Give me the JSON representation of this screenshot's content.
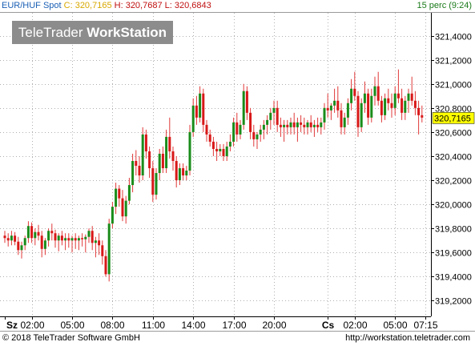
{
  "header": {
    "symbol": "EUR/HUF Spot",
    "close": "C: 320,7165",
    "high": "H: 320,7687",
    "low": "L: 320,6843",
    "interval": "15 perc (9:24)"
  },
  "logo": {
    "brand_light": "TeleTrader ",
    "brand_bold": "WorkStation"
  },
  "footer": {
    "copyright": "© 2018 TeleTrader Software GmbH",
    "url": "http://workstation.teletrader.com"
  },
  "colors": {
    "up": "#1a8c1a",
    "down": "#d81818",
    "wick": "#e03838",
    "grid": "#b0b0b0",
    "last_price_bg": "#ffff00"
  },
  "chart_data": {
    "type": "candlestick",
    "title": "EUR/HUF Spot",
    "interval": "15 perc",
    "last_price_label": "320,7165",
    "last_price": 320.7165,
    "y_ticks": [
      {
        "value": 321.4,
        "label": "321,4000"
      },
      {
        "value": 321.2,
        "label": "321,2000"
      },
      {
        "value": 321.0,
        "label": "321,0000"
      },
      {
        "value": 320.8,
        "label": "320,8000"
      },
      {
        "value": 320.6,
        "label": "320,6000"
      },
      {
        "value": 320.4,
        "label": "320,4000"
      },
      {
        "value": 320.2,
        "label": "320,2000"
      },
      {
        "value": 320.0,
        "label": "320,0000"
      },
      {
        "value": 319.8,
        "label": "319,8000"
      },
      {
        "value": 319.6,
        "label": "319,6000"
      },
      {
        "value": 319.4,
        "label": "319,4000"
      },
      {
        "value": 319.2,
        "label": "319,2000"
      }
    ],
    "ylim": [
      319.07,
      321.59
    ],
    "x_ticks": [
      {
        "bar": 0,
        "label": "Sz",
        "bold": true
      },
      {
        "bar": 8,
        "label": "02:00",
        "bold": false
      },
      {
        "bar": 20,
        "label": "05:00",
        "bold": false
      },
      {
        "bar": 32,
        "label": "08:00",
        "bold": false
      },
      {
        "bar": 44,
        "label": "11:00",
        "bold": false
      },
      {
        "bar": 56,
        "label": "14:00",
        "bold": false
      },
      {
        "bar": 68,
        "label": "17:00",
        "bold": false
      },
      {
        "bar": 80,
        "label": "20:00",
        "bold": false
      },
      {
        "bar": 96,
        "label": "Cs",
        "bold": true
      },
      {
        "bar": 104,
        "label": "02:00",
        "bold": false
      },
      {
        "bar": 116,
        "label": "05:00",
        "bold": false
      },
      {
        "bar": 125,
        "label": "07:15",
        "bold": false
      }
    ],
    "grid": true,
    "candles": [
      [
        319.74,
        319.78,
        319.68,
        319.72
      ],
      [
        319.72,
        319.76,
        319.65,
        319.7
      ],
      [
        319.7,
        319.78,
        319.66,
        319.74
      ],
      [
        319.74,
        319.77,
        319.66,
        319.69
      ],
      [
        319.69,
        319.73,
        319.58,
        319.62
      ],
      [
        319.62,
        319.69,
        319.55,
        319.66
      ],
      [
        319.66,
        319.74,
        319.62,
        319.72
      ],
      [
        319.72,
        319.86,
        319.68,
        319.82
      ],
      [
        319.82,
        319.85,
        319.68,
        319.72
      ],
      [
        319.72,
        319.8,
        319.66,
        319.77
      ],
      [
        319.77,
        319.83,
        319.7,
        319.74
      ],
      [
        319.74,
        319.78,
        319.56,
        319.63
      ],
      [
        319.63,
        319.72,
        319.58,
        319.7
      ],
      [
        319.7,
        319.8,
        319.65,
        319.78
      ],
      [
        319.78,
        319.84,
        319.7,
        319.76
      ],
      [
        319.76,
        319.79,
        319.64,
        319.7
      ],
      [
        319.7,
        319.76,
        319.61,
        319.74
      ],
      [
        319.74,
        319.78,
        319.66,
        319.7
      ],
      [
        319.7,
        319.76,
        319.62,
        319.72
      ],
      [
        319.72,
        319.76,
        319.64,
        319.7
      ],
      [
        319.7,
        319.74,
        319.6,
        319.72
      ],
      [
        319.72,
        319.76,
        319.63,
        319.7
      ],
      [
        319.7,
        319.74,
        319.62,
        319.72
      ],
      [
        319.72,
        319.76,
        319.65,
        319.71
      ],
      [
        319.71,
        319.75,
        319.6,
        319.73
      ],
      [
        319.73,
        319.8,
        319.68,
        319.78
      ],
      [
        319.78,
        319.82,
        319.62,
        319.68
      ],
      [
        319.68,
        319.73,
        319.56,
        319.7
      ],
      [
        319.7,
        319.76,
        319.58,
        319.66
      ],
      [
        319.66,
        319.7,
        319.5,
        319.57
      ],
      [
        319.57,
        319.62,
        319.4,
        319.42
      ],
      [
        319.42,
        319.88,
        319.36,
        319.84
      ],
      [
        319.84,
        320.02,
        319.8,
        319.98
      ],
      [
        319.98,
        320.18,
        319.92,
        320.13
      ],
      [
        320.13,
        320.16,
        319.98,
        320.05
      ],
      [
        320.05,
        320.12,
        319.86,
        319.9
      ],
      [
        319.9,
        320.07,
        319.84,
        320.03
      ],
      [
        320.03,
        320.22,
        320.0,
        320.16
      ],
      [
        320.16,
        320.42,
        320.1,
        320.36
      ],
      [
        320.36,
        320.45,
        320.24,
        320.32
      ],
      [
        320.32,
        320.4,
        320.18,
        320.24
      ],
      [
        320.24,
        320.64,
        320.2,
        320.58
      ],
      [
        320.58,
        320.62,
        320.38,
        320.44
      ],
      [
        320.44,
        320.48,
        320.22,
        320.3
      ],
      [
        320.3,
        320.36,
        320.02,
        320.08
      ],
      [
        320.08,
        320.3,
        320.04,
        320.26
      ],
      [
        320.26,
        320.46,
        320.2,
        320.42
      ],
      [
        320.42,
        320.48,
        320.26,
        320.3
      ],
      [
        320.3,
        320.62,
        320.26,
        320.56
      ],
      [
        320.56,
        320.72,
        320.38,
        320.44
      ],
      [
        320.44,
        320.48,
        320.28,
        320.36
      ],
      [
        320.36,
        320.4,
        320.14,
        320.2
      ],
      [
        320.2,
        320.34,
        320.16,
        320.3
      ],
      [
        320.3,
        320.34,
        320.2,
        320.24
      ],
      [
        320.24,
        320.32,
        320.2,
        320.28
      ],
      [
        320.28,
        320.66,
        320.24,
        320.6
      ],
      [
        320.6,
        320.88,
        320.56,
        320.82
      ],
      [
        320.82,
        320.9,
        320.66,
        320.72
      ],
      [
        320.72,
        320.98,
        320.68,
        320.92
      ],
      [
        320.92,
        320.96,
        320.6,
        320.66
      ],
      [
        320.66,
        320.7,
        320.52,
        320.58
      ],
      [
        320.58,
        320.62,
        320.48,
        320.52
      ],
      [
        320.52,
        320.56,
        320.4,
        320.46
      ],
      [
        320.46,
        320.52,
        320.36,
        320.44
      ],
      [
        320.44,
        320.5,
        320.4,
        320.46
      ],
      [
        320.46,
        320.5,
        320.36,
        320.4
      ],
      [
        320.4,
        320.52,
        320.36,
        320.48
      ],
      [
        320.48,
        320.58,
        320.44,
        320.52
      ],
      [
        320.52,
        320.72,
        320.48,
        320.68
      ],
      [
        320.68,
        320.76,
        320.52,
        320.58
      ],
      [
        320.58,
        320.7,
        320.54,
        320.66
      ],
      [
        320.66,
        321.0,
        320.62,
        320.94
      ],
      [
        320.94,
        320.98,
        320.7,
        320.76
      ],
      [
        320.76,
        320.8,
        320.54,
        320.6
      ],
      [
        320.6,
        320.66,
        320.48,
        320.54
      ],
      [
        320.54,
        320.6,
        320.46,
        320.58
      ],
      [
        320.58,
        320.66,
        320.52,
        320.62
      ],
      [
        320.62,
        320.7,
        320.54,
        320.66
      ],
      [
        320.66,
        320.74,
        320.58,
        320.7
      ],
      [
        320.7,
        320.8,
        320.62,
        320.76
      ],
      [
        320.76,
        320.86,
        320.66,
        320.8
      ],
      [
        320.8,
        320.86,
        320.6,
        320.66
      ],
      [
        320.66,
        320.72,
        320.56,
        320.64
      ],
      [
        320.64,
        320.7,
        320.52,
        320.66
      ],
      [
        320.66,
        320.7,
        320.58,
        320.64
      ],
      [
        320.64,
        320.72,
        320.58,
        320.68
      ],
      [
        320.68,
        320.76,
        320.58,
        320.64
      ],
      [
        320.64,
        320.72,
        320.52,
        320.68
      ],
      [
        320.68,
        320.74,
        320.6,
        320.66
      ],
      [
        320.66,
        320.72,
        320.58,
        320.64
      ],
      [
        320.64,
        320.7,
        320.58,
        320.68
      ],
      [
        320.68,
        320.74,
        320.6,
        320.64
      ],
      [
        320.64,
        320.7,
        320.56,
        320.66
      ],
      [
        320.66,
        320.72,
        320.6,
        320.64
      ],
      [
        320.64,
        320.72,
        320.58,
        320.68
      ],
      [
        320.68,
        320.84,
        320.62,
        320.8
      ],
      [
        320.8,
        320.92,
        320.72,
        320.78
      ],
      [
        320.78,
        320.84,
        320.7,
        320.82
      ],
      [
        320.82,
        320.96,
        320.76,
        320.86
      ],
      [
        320.86,
        320.98,
        320.72,
        320.78
      ],
      [
        320.78,
        320.84,
        320.58,
        320.64
      ],
      [
        320.64,
        320.76,
        320.58,
        320.72
      ],
      [
        320.72,
        320.88,
        320.66,
        320.84
      ],
      [
        320.84,
        321.04,
        320.78,
        320.96
      ],
      [
        320.96,
        321.1,
        320.86,
        320.9
      ],
      [
        320.9,
        320.94,
        320.56,
        320.64
      ],
      [
        320.64,
        320.88,
        320.6,
        320.84
      ],
      [
        320.84,
        321.02,
        320.76,
        320.92
      ],
      [
        320.92,
        320.96,
        320.66,
        320.72
      ],
      [
        320.72,
        320.96,
        320.68,
        320.9
      ],
      [
        320.9,
        321.06,
        320.82,
        320.98
      ],
      [
        320.98,
        321.1,
        320.82,
        320.86
      ],
      [
        320.86,
        320.9,
        320.68,
        320.74
      ],
      [
        320.74,
        320.92,
        320.7,
        320.88
      ],
      [
        320.88,
        320.96,
        320.78,
        320.84
      ],
      [
        320.84,
        320.92,
        320.72,
        320.8
      ],
      [
        320.8,
        320.98,
        320.74,
        320.92
      ],
      [
        320.92,
        321.12,
        320.84,
        320.88
      ],
      [
        320.88,
        320.96,
        320.7,
        320.76
      ],
      [
        320.76,
        320.9,
        320.7,
        320.86
      ],
      [
        320.86,
        320.96,
        320.76,
        320.92
      ],
      [
        320.92,
        321.06,
        320.82,
        320.86
      ],
      [
        320.86,
        320.94,
        320.74,
        320.8
      ],
      [
        320.8,
        320.86,
        320.58,
        320.74
      ],
      [
        320.74,
        320.82,
        320.68,
        320.72
      ]
    ]
  }
}
